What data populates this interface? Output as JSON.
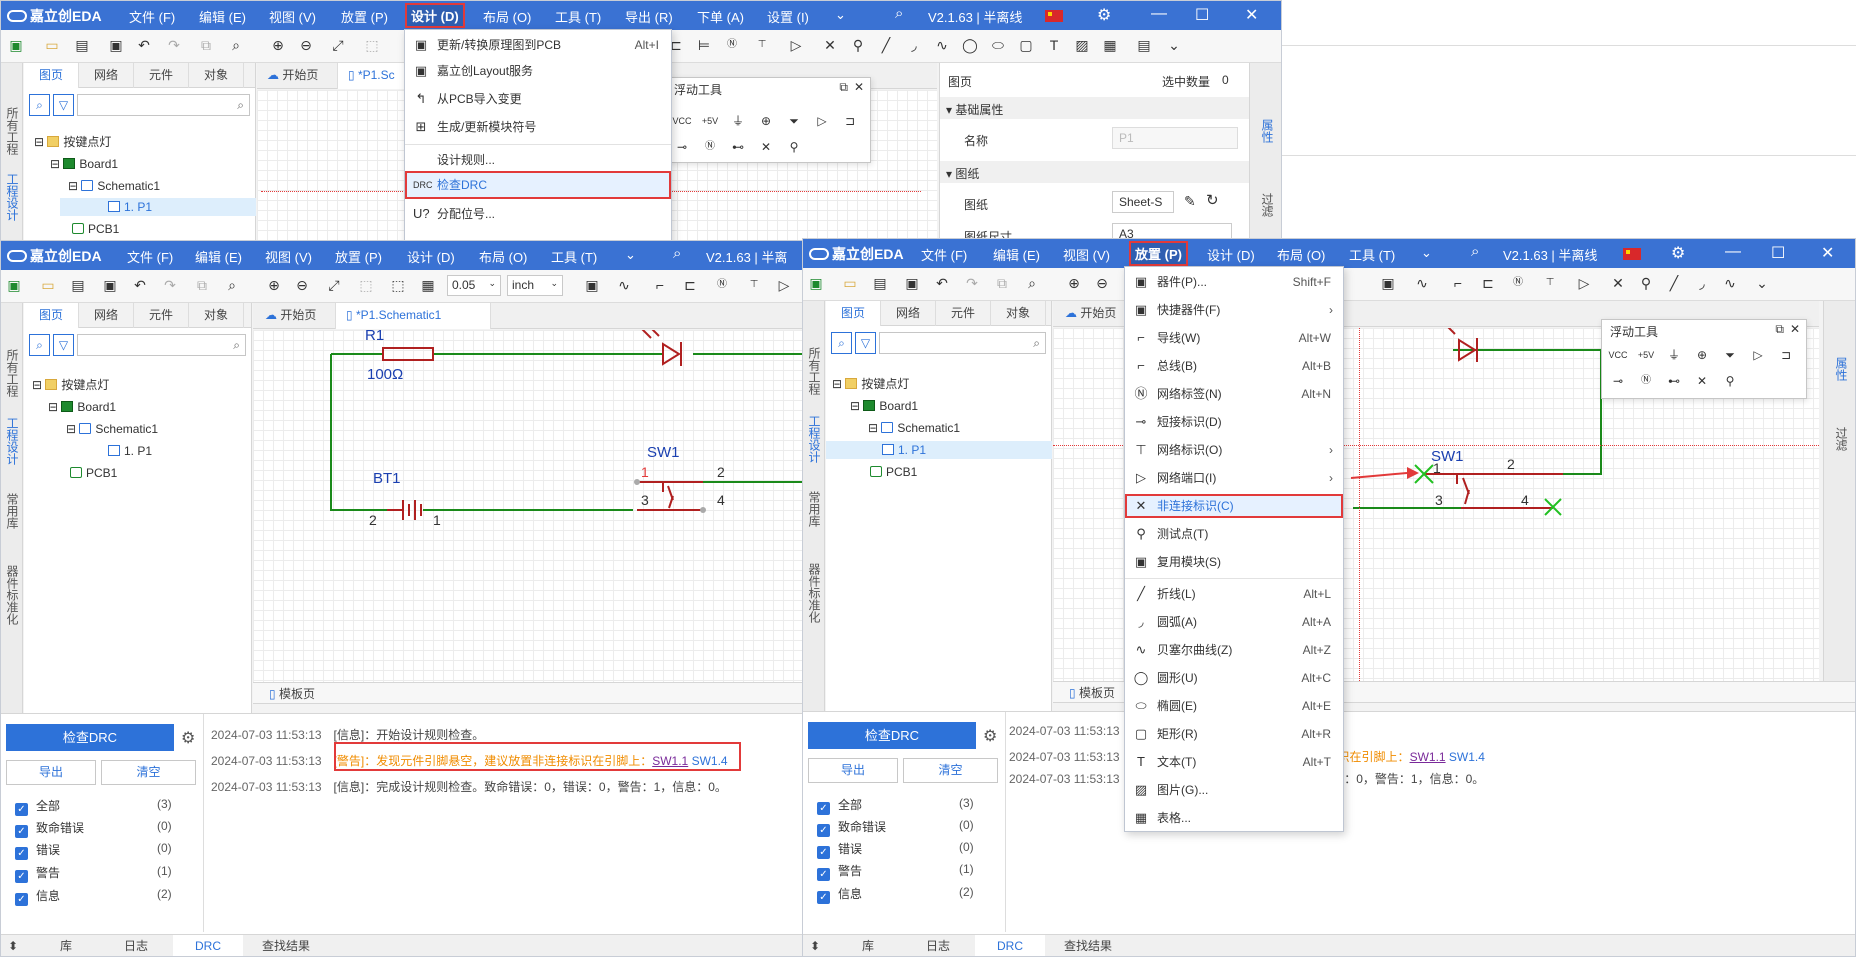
{
  "app": {
    "logo": "嘉立创EDA",
    "version": "V2.1.63 | 半离线",
    "version_short": "V2.1.63 | 半离线",
    "version_trunc": "V2.1.63 | 半离",
    "minimize": "—",
    "maximize": "☐",
    "close": "✕"
  },
  "menus": {
    "file": "文件 (F)",
    "edit": "编辑 (E)",
    "view": "视图 (V)",
    "place": "放置 (P)",
    "design": "设计 (D)",
    "layout": "布局 (O)",
    "tools": "工具 (T)",
    "export": "导出 (R)",
    "order": "下单 (A)",
    "settings": "设置 (I)"
  },
  "toolbar": {
    "grid_value": "0.05",
    "unit": "inch"
  },
  "side_tabs": {
    "all_projects": "所有工程",
    "project_design": "工程设计",
    "common_lib": "常用库",
    "standardize": "器件标准化"
  },
  "panel": {
    "tabs": [
      "图页",
      "网络",
      "元件",
      "对象"
    ],
    "tree": {
      "project": "按键点灯",
      "board": "Board1",
      "schematic": "Schematic1",
      "page": "1. P1",
      "pcb": "PCB1"
    }
  },
  "doc_tabs": {
    "start": "开始页",
    "schematic": "*P1.Schematic1",
    "schematic_trunc": "*P1.Sc",
    "template": "模板页"
  },
  "design_menu": [
    {
      "label": "更新/转换原理图到PCB",
      "shortcut": "Alt+I",
      "icon": "convert-icon"
    },
    {
      "label": "嘉立创Layout服务",
      "shortcut": "",
      "icon": "layout-service-icon"
    },
    {
      "label": "从PCB导入变更",
      "shortcut": "",
      "icon": "import-icon"
    },
    {
      "label": "生成/更新模块符号",
      "shortcut": "",
      "icon": "module-icon"
    },
    {
      "label": "设计规则...",
      "shortcut": "",
      "icon": ""
    },
    {
      "label": "检查DRC",
      "shortcut": "",
      "icon": "drc-icon",
      "icon_text": "DRC"
    },
    {
      "label": "分配位号...",
      "shortcut": "",
      "icon": "assign-icon",
      "icon_text": "U?"
    }
  ],
  "place_menu": [
    {
      "label": "器件(P)...",
      "shortcut": "Shift+F",
      "icon": "component-icon",
      "glyph": "▣"
    },
    {
      "label": "快捷器件(F)",
      "shortcut": "",
      "arrow": true,
      "icon": "quick-component-icon",
      "glyph": "▣"
    },
    {
      "label": "导线(W)",
      "shortcut": "Alt+W",
      "icon": "wire-icon",
      "glyph": "⌐"
    },
    {
      "label": "总线(B)",
      "shortcut": "Alt+B",
      "icon": "bus-icon",
      "glyph": "⌐"
    },
    {
      "label": "网络标签(N)",
      "shortcut": "Alt+N",
      "icon": "net-label-icon",
      "glyph": "Ⓝ"
    },
    {
      "label": "短接标识(D)",
      "shortcut": "",
      "icon": "short-flag-icon",
      "glyph": "⊸"
    },
    {
      "label": "网络标识(O)",
      "shortcut": "",
      "arrow": true,
      "icon": "net-flag-icon",
      "glyph": "⊤"
    },
    {
      "label": "网络端口(I)",
      "shortcut": "",
      "arrow": true,
      "icon": "net-port-icon",
      "glyph": "▷"
    },
    {
      "label": "非连接标识(C)",
      "shortcut": "",
      "icon": "no-connect-icon",
      "glyph": "✕"
    },
    {
      "label": "测试点(T)",
      "shortcut": "",
      "icon": "test-point-icon",
      "glyph": "⚲"
    },
    {
      "label": "复用模块(S)",
      "shortcut": "",
      "icon": "reuse-module-icon",
      "glyph": "▣"
    },
    {
      "label": "折线(L)",
      "shortcut": "Alt+L",
      "icon": "polyline-icon",
      "glyph": "╱"
    },
    {
      "label": "圆弧(A)",
      "shortcut": "Alt+A",
      "icon": "arc-icon",
      "glyph": "◞"
    },
    {
      "label": "贝塞尔曲线(Z)",
      "shortcut": "Alt+Z",
      "icon": "bezier-icon",
      "glyph": "∿"
    },
    {
      "label": "圆形(U)",
      "shortcut": "Alt+C",
      "icon": "circle-icon",
      "glyph": "◯"
    },
    {
      "label": "椭圆(E)",
      "shortcut": "Alt+E",
      "icon": "ellipse-icon",
      "glyph": "⬭"
    },
    {
      "label": "矩形(R)",
      "shortcut": "Alt+R",
      "icon": "rectangle-icon",
      "glyph": "▢"
    },
    {
      "label": "文本(T)",
      "shortcut": "Alt+T",
      "icon": "text-icon",
      "glyph": "T"
    },
    {
      "label": "图片(G)...",
      "shortcut": "",
      "icon": "image-icon",
      "glyph": "▨"
    },
    {
      "label": "表格...",
      "shortcut": "",
      "icon": "table-icon",
      "glyph": "▦"
    }
  ],
  "float_tool": {
    "title": "浮动工具"
  },
  "properties": {
    "header": "图页",
    "sel_count_label": "选中数量",
    "sel_count": "0",
    "basic": "基础属性",
    "name_label": "名称",
    "name_value": "P1",
    "paper": "图纸",
    "paper_label": "图纸",
    "paper_value": "Sheet-S",
    "size_label": "图纸尺寸",
    "size_value": "A3",
    "tab_props": "属性",
    "tab_filter": "过滤"
  },
  "schematic": {
    "r1": "R1",
    "r1_value": "100Ω",
    "bt1": "BT1",
    "sw1": "SW1",
    "pin1": "1",
    "pin2": "2",
    "pin3": "3",
    "pin4": "4"
  },
  "drc": {
    "check_button": "检查DRC",
    "export": "导出",
    "clear": "清空",
    "filters": [
      {
        "label": "全部",
        "count": "(3)"
      },
      {
        "label": "致命错误",
        "count": "(0)"
      },
      {
        "label": "错误",
        "count": "(0)"
      },
      {
        "label": "警告",
        "count": "(1)"
      },
      {
        "label": "信息",
        "count": "(2)"
      }
    ],
    "logs": [
      {
        "time": "2024-07-03 11:53:13",
        "text": "[信息]：开始设计规则检查。"
      },
      {
        "time": "2024-07-03 11:53:13",
        "text": "[警告]：发现元件引脚悬空，建议放置非连接标识在引脚上：",
        "link1": "SW1.1",
        "link2": "SW1.4"
      },
      {
        "time": "2024-07-03 11:53:13",
        "text": "[信息]：完成设计规则检查。致命错误：0，错误：0，警告：1，信息：0。"
      }
    ],
    "log2_partial": "连接标识在引脚上：",
    "log3_partial": "0，错误：0，警告：1，信息：0。"
  },
  "bottom_tabs": [
    "库",
    "日志",
    "DRC",
    "查找结果"
  ],
  "colors": {
    "titlebar": "#3a72d3",
    "accent": "#2d72d9",
    "highlight_red": "#e23a3a",
    "wire_green": "#1a8a1a",
    "component_red": "#b02020",
    "label_blue": "#1a3fb0",
    "warning": "#f08c00"
  }
}
